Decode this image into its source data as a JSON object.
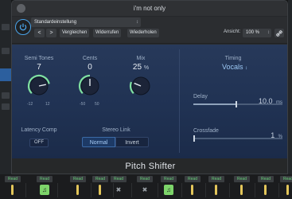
{
  "window": {
    "title": "i'm not only"
  },
  "toolbar": {
    "preset": "Standardeinstellung",
    "prev": "<",
    "next": ">",
    "compare": "Vergleichen",
    "undo": "Widerrufen",
    "redo": "Wiederholen",
    "view_label": "Ansicht:",
    "zoom": "100 %"
  },
  "plugin": {
    "semitones": {
      "label": "Semi Tones",
      "value": "7",
      "min": "-12",
      "max": "12",
      "level": 0.79
    },
    "cents": {
      "label": "Cents",
      "value": "0",
      "min": "-50",
      "max": "50",
      "level": 0.5
    },
    "mix": {
      "label": "Mix",
      "value": "25",
      "unit": "%",
      "level": 0.25
    },
    "timing": {
      "label": "Timing",
      "value": "Vocals"
    },
    "delay": {
      "label": "Delay",
      "value": "10.0",
      "unit": "ms",
      "level": 0.48
    },
    "crossfade": {
      "label": "Crossfade",
      "value": "1",
      "unit": "%",
      "level": 0.01
    },
    "latency_comp": {
      "label": "Latency Comp",
      "value": "OFF"
    },
    "stereo_link": {
      "label": "Stereo Link",
      "options": [
        "Normal",
        "Invert"
      ],
      "selected": "Normal"
    },
    "name": "Pitch Shifter"
  },
  "strips": {
    "read_label": "Read"
  },
  "colors": {
    "accent": "#4aa3e8",
    "knob_arc": "#7fe0a0",
    "read_green": "#66d17a"
  }
}
